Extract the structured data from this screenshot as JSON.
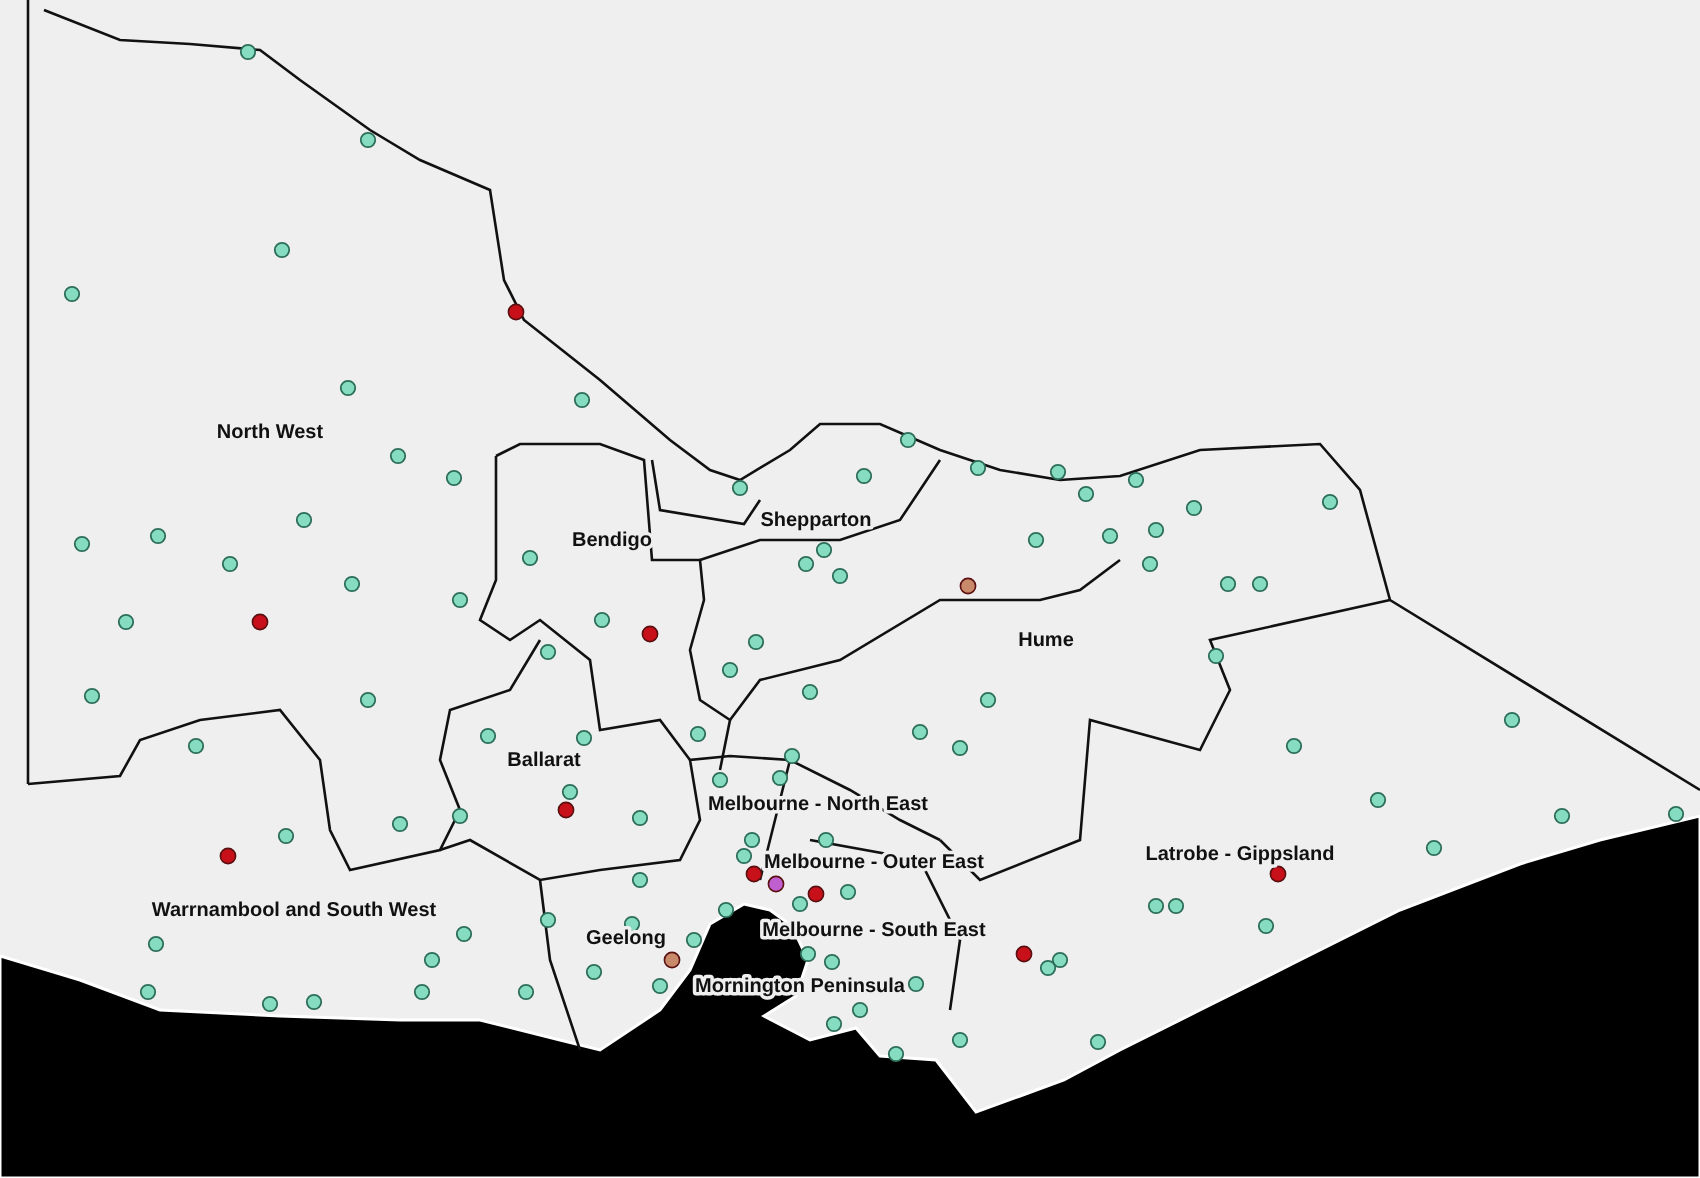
{
  "map": {
    "regions": [
      {
        "label": "North West"
      },
      {
        "label": "Shepparton"
      },
      {
        "label": "Bendigo"
      },
      {
        "label": "Hume"
      },
      {
        "label": "Ballarat"
      },
      {
        "label": "Melbourne - North East"
      },
      {
        "label": "Melbourne - Outer East"
      },
      {
        "label": "Latrobe - Gippsland"
      },
      {
        "label": "Warrnambool and South West"
      },
      {
        "label": "Geelong"
      },
      {
        "label": "Melbourne - South East"
      },
      {
        "label": "Mornington Peninsula"
      }
    ],
    "markers": [
      {
        "color": "#c8101a"
      },
      {
        "color": "#c8101a"
      },
      {
        "color": "#c8101a"
      },
      {
        "color": "#c8101a"
      },
      {
        "color": "#c8101a"
      },
      {
        "color": "#c8101a"
      },
      {
        "color": "#c8101a"
      },
      {
        "color": "#c8101a"
      },
      {
        "color": "#c8101a"
      },
      {
        "color": "#c88a6a"
      },
      {
        "color": "#c88a6a"
      },
      {
        "color": "#c060d0"
      }
    ]
  }
}
